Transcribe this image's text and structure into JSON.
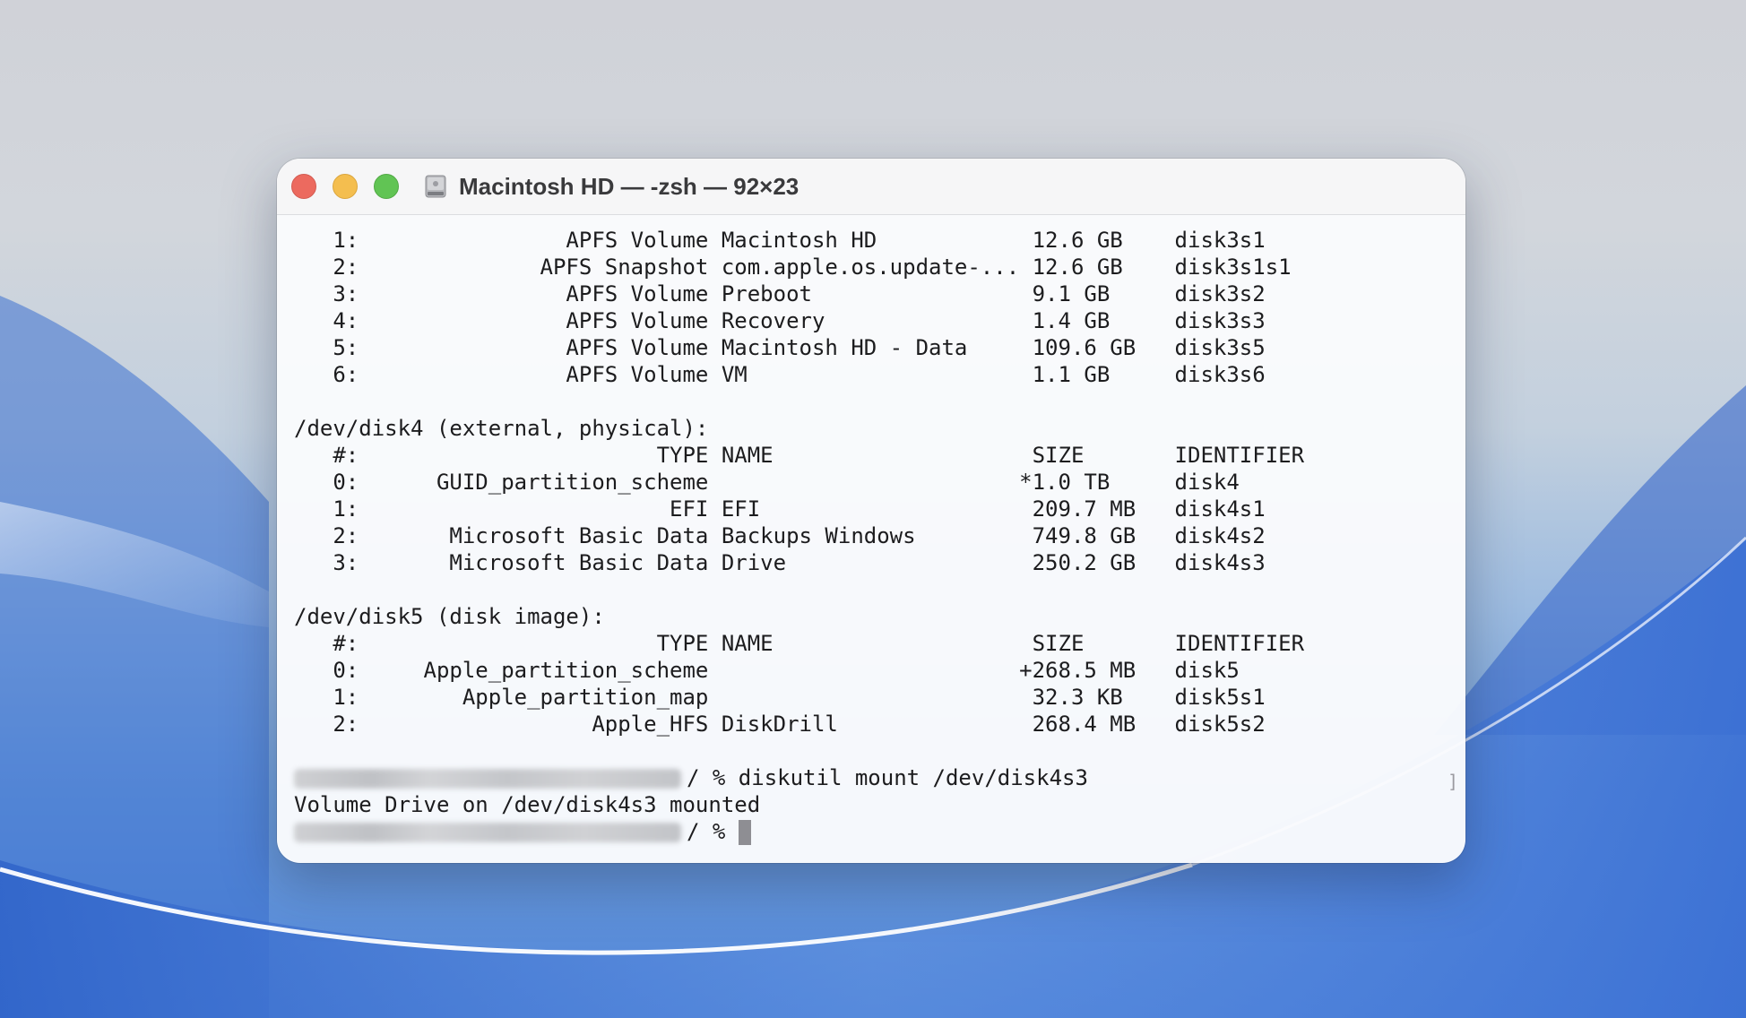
{
  "window": {
    "title": "Macintosh HD — -zsh — 92×23",
    "icon": "hard-disk-icon"
  },
  "colors": {
    "close": "#ec6a5f",
    "minimize": "#f4be4f",
    "maximize": "#61c454",
    "text": "#1c1c1e"
  },
  "terminal": {
    "lines": [
      "   1:                APFS Volume Macintosh HD            12.6 GB    disk3s1",
      "   2:              APFS Snapshot com.apple.os.update-... 12.6 GB    disk3s1s1",
      "   3:                APFS Volume Preboot                 9.1 GB     disk3s2",
      "   4:                APFS Volume Recovery                1.4 GB     disk3s3",
      "   5:                APFS Volume Macintosh HD - Data     109.6 GB   disk3s5",
      "   6:                APFS Volume VM                      1.1 GB     disk3s6",
      "",
      "/dev/disk4 (external, physical):",
      "   #:                       TYPE NAME                    SIZE       IDENTIFIER",
      "   0:      GUID_partition_scheme                        *1.0 TB     disk4",
      "   1:                        EFI EFI                     209.7 MB   disk4s1",
      "   2:       Microsoft Basic Data Backups Windows         749.8 GB   disk4s2",
      "   3:       Microsoft Basic Data Drive                   250.2 GB   disk4s3",
      "",
      "/dev/disk5 (disk image):",
      "   #:                       TYPE NAME                    SIZE       IDENTIFIER",
      "   0:     Apple_partition_scheme                        +268.5 MB   disk5",
      "   1:        Apple_partition_map                         32.3 KB    disk5s1",
      "   2:                  Apple_HFS DiskDrill               268.4 MB   disk5s2",
      ""
    ],
    "prompt_suffix": "/ % ",
    "command": "diskutil mount /dev/disk4s3",
    "output": "Volume Drive on /dev/disk4s3 mounted",
    "scroll_marker": "]"
  }
}
